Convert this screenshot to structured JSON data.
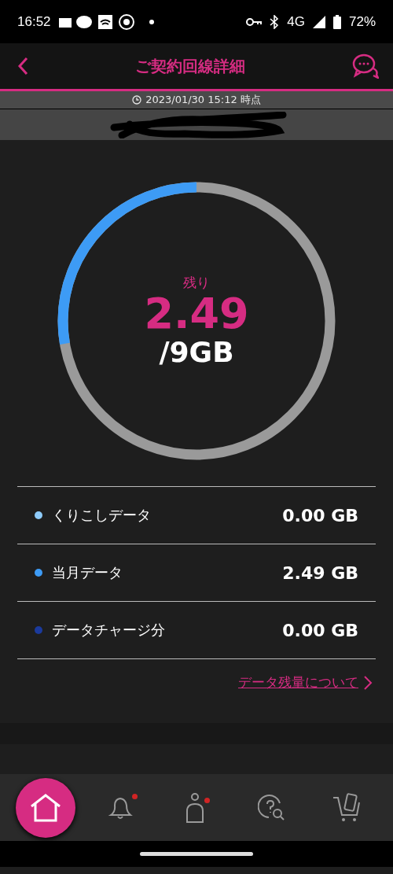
{
  "status_bar": {
    "time": "16:52",
    "network": "4G",
    "battery": "72%"
  },
  "header": {
    "title": "ご契約回線詳細"
  },
  "timestamp": "2023/01/30 15:12 時点",
  "usage": {
    "label": "残り",
    "remaining": "2.49",
    "total": "/9GB",
    "level": 0.277
  },
  "breakdown": [
    {
      "name": "くりこしデータ",
      "amount": "0.00 GB",
      "color": "#8ecbfa"
    },
    {
      "name": "当月データ",
      "amount": "2.49 GB",
      "color": "#3d9bf5"
    },
    {
      "name": "データチャージ分",
      "amount": "0.00 GB",
      "color": "#1b3a9c"
    }
  ],
  "link": "データ残量について",
  "nav": [
    {
      "kind": "home",
      "selected": true,
      "badge": false
    },
    {
      "kind": "bell",
      "selected": false,
      "badge": true
    },
    {
      "kind": "person",
      "selected": false,
      "badge": true
    },
    {
      "kind": "help",
      "selected": false,
      "badge": false
    },
    {
      "kind": "cart",
      "selected": false,
      "badge": false
    }
  ]
}
